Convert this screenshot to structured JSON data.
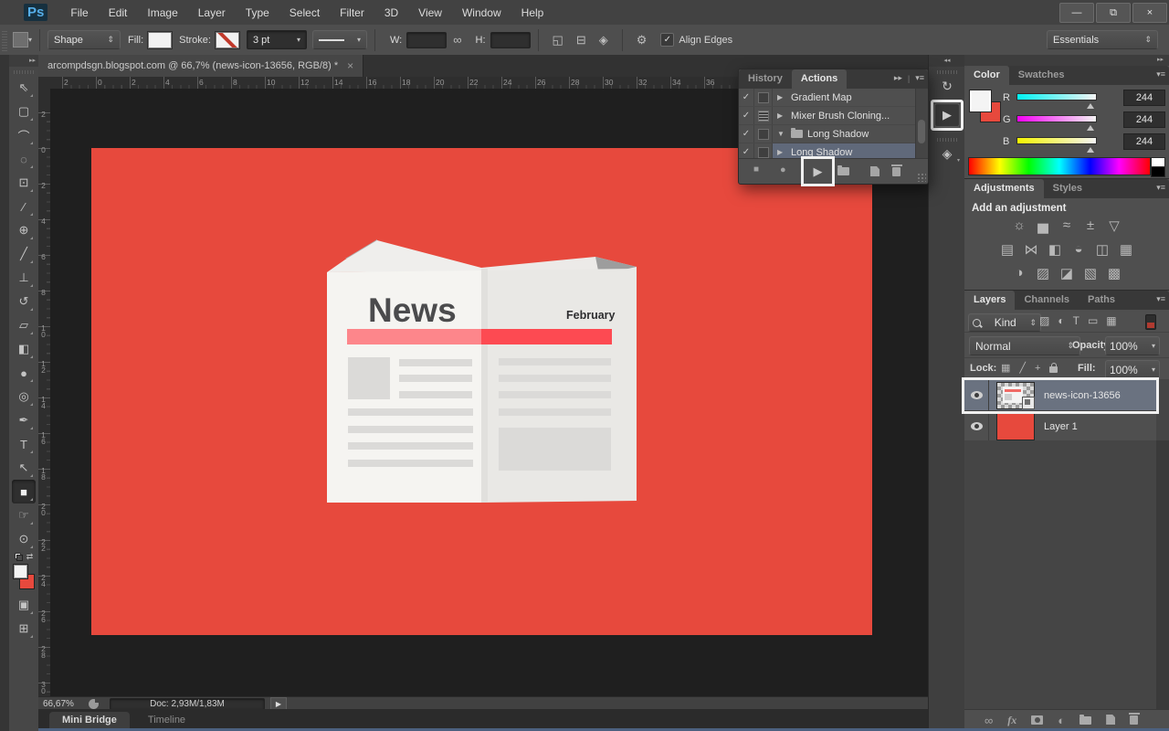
{
  "colors": {
    "canvas_red": "#e7493d",
    "banner_left": "#fd868b",
    "banner_right": "#fd4a52",
    "selection_blue": "#6a7280",
    "annotation_white": "#f0f0f0"
  },
  "window": {
    "controls": [
      {
        "name": "minimize-button",
        "glyph": "—"
      },
      {
        "name": "restore-button",
        "glyph": "⧉"
      },
      {
        "name": "close-button",
        "glyph": "×"
      }
    ]
  },
  "menubar": {
    "logo": "Ps",
    "items": [
      "File",
      "Edit",
      "Image",
      "Layer",
      "Type",
      "Select",
      "Filter",
      "3D",
      "View",
      "Window",
      "Help"
    ]
  },
  "options_bar": {
    "tool_mode": "Shape",
    "fill_label": "Fill:",
    "stroke_label": "Stroke:",
    "stroke_width": "3 pt",
    "w_label": "W:",
    "h_label": "H:",
    "align_edges_label": "Align Edges",
    "align_edges_checked": "✓",
    "workspace": "Essentials",
    "icons": [
      {
        "name": "path-operations-icon",
        "glyph": "◱"
      },
      {
        "name": "path-alignment-icon",
        "glyph": "⊟"
      },
      {
        "name": "path-arrangement-icon",
        "glyph": "◈"
      },
      {
        "name": "gear-icon",
        "glyph": "⚙"
      },
      {
        "name": "link-dimensions-icon",
        "glyph": "∞"
      }
    ]
  },
  "document": {
    "tab_title": "arcompdsgn.blogspot.com @ 66,7% (news-icon-13656, RGB/8) *",
    "close_glyph": "×",
    "ruler_h": [
      "2",
      "0",
      "2",
      "4",
      "6",
      "8",
      "10",
      "12",
      "14",
      "16",
      "18",
      "20",
      "22",
      "24",
      "26",
      "28",
      "30",
      "32",
      "34",
      "36"
    ],
    "ruler_v": [
      "2",
      "0",
      "2",
      "4",
      "6",
      "8",
      "10",
      "12",
      "14",
      "16",
      "18",
      "20",
      "22",
      "24",
      "26",
      "28",
      "30"
    ],
    "status": {
      "zoom": "66,67%",
      "doc_info": "Doc: 2,93M/1,83M"
    },
    "bottom_tabs": [
      {
        "label": "Mini Bridge",
        "cls": "active"
      },
      {
        "label": "Timeline",
        "cls": ""
      }
    ]
  },
  "artwork": {
    "title": "News",
    "date": "February"
  },
  "toolbar": {
    "collapse_glyph": "▸▸",
    "swap_glyph": "⇄",
    "tools": [
      {
        "name": "move-tool",
        "glyph": "⇖"
      },
      {
        "name": "rectangular-marquee-tool",
        "glyph": "▢"
      },
      {
        "name": "lasso-tool",
        "glyph": "⌒"
      },
      {
        "name": "quick-selection-tool",
        "glyph": "◌"
      },
      {
        "name": "crop-tool",
        "glyph": "⊡"
      },
      {
        "name": "eyedropper-tool",
        "glyph": "∕"
      },
      {
        "name": "spot-healing-brush-tool",
        "glyph": "⊕"
      },
      {
        "name": "brush-tool",
        "glyph": "╱"
      },
      {
        "name": "clone-stamp-tool",
        "glyph": "⊥"
      },
      {
        "name": "history-brush-tool",
        "glyph": "↺"
      },
      {
        "name": "eraser-tool",
        "glyph": "▱"
      },
      {
        "name": "gradient-tool",
        "glyph": "◧"
      },
      {
        "name": "blur-tool",
        "glyph": "●"
      },
      {
        "name": "dodge-tool",
        "glyph": "◎"
      },
      {
        "name": "pen-tool",
        "glyph": "✒"
      },
      {
        "name": "type-tool",
        "glyph": "T"
      },
      {
        "name": "path-selection-tool",
        "glyph": "↖"
      },
      {
        "name": "rectangle-tool",
        "glyph": "■",
        "cls": "selected"
      },
      {
        "name": "hand-tool",
        "glyph": "☞"
      },
      {
        "name": "zoom-tool",
        "glyph": "⊙"
      }
    ],
    "tools_bottom": [
      {
        "name": "quick-mask-tool",
        "glyph": "▣"
      },
      {
        "name": "screen-mode-tool",
        "glyph": "⊞"
      }
    ]
  },
  "actions_panel": {
    "tabs": [
      {
        "label": "History",
        "cls": ""
      },
      {
        "label": "Actions",
        "cls": "active"
      }
    ],
    "expand_glyph": "▸▸",
    "menu_glyph": "▾≡",
    "items": [
      {
        "check": "✓",
        "arrow": "▶",
        "label": "Gradient Map",
        "cls": ""
      },
      {
        "check": "✓",
        "arrow": "▶",
        "label": "Mixer Brush Cloning...",
        "cls": "modal"
      },
      {
        "check": "✓",
        "arrow": "▼",
        "label": "Long Shadow",
        "cls": "set"
      },
      {
        "check": "✓",
        "arrow": "▶",
        "label": "Long Shadow",
        "cls": "selected"
      }
    ],
    "buttons": [
      {
        "name": "stop-playing-button",
        "glyph": "■"
      },
      {
        "name": "begin-recording-button",
        "glyph": "●"
      },
      {
        "name": "play-selection-button",
        "glyph": "▶"
      },
      {
        "name": "create-new-set-button"
      },
      {
        "name": "create-new-action-button"
      },
      {
        "name": "delete-action-button"
      }
    ]
  },
  "dock_strip": {
    "collapse_glyph": "◂◂",
    "icons": [
      {
        "name": "collapsed-history-panel-icon",
        "glyph": "↻"
      },
      {
        "name": "collapsed-actions-play-button",
        "glyph": "▶"
      },
      {
        "name": "collapsed-properties-panel-icon",
        "glyph": "◈"
      }
    ]
  },
  "dock": {
    "collapse_glyph": "▸▸"
  },
  "color_panel": {
    "tabs": [
      {
        "label": "Color",
        "cls": "active"
      },
      {
        "label": "Swatches",
        "cls": ""
      }
    ],
    "menu_glyph": "▾≡",
    "channels": [
      {
        "label": "R",
        "value": "244",
        "cls": "r"
      },
      {
        "label": "G",
        "value": "244",
        "cls": "g"
      },
      {
        "label": "B",
        "value": "244",
        "cls": "b"
      }
    ]
  },
  "adjustments_panel": {
    "tabs": [
      {
        "label": "Adjustments",
        "cls": "active"
      },
      {
        "label": "Styles",
        "cls": ""
      }
    ],
    "menu_glyph": "▾≡",
    "heading": "Add an adjustment",
    "row1": [
      {
        "name": "brightness-contrast-icon",
        "glyph": "☼"
      },
      {
        "name": "levels-icon",
        "glyph": "▅"
      },
      {
        "name": "curves-icon",
        "glyph": "≈"
      },
      {
        "name": "exposure-icon",
        "glyph": "±"
      },
      {
        "name": "vibrance-icon",
        "glyph": "▽"
      }
    ],
    "row2": [
      {
        "name": "hue-saturation-icon",
        "glyph": "▤"
      },
      {
        "name": "color-balance-icon",
        "glyph": "⋈"
      },
      {
        "name": "black-white-icon",
        "glyph": "◧"
      },
      {
        "name": "photo-filter-icon",
        "glyph": "◒"
      },
      {
        "name": "channel-mixer-icon",
        "glyph": "◫"
      },
      {
        "name": "color-lookup-icon",
        "glyph": "▦"
      }
    ],
    "row3": [
      {
        "name": "invert-icon",
        "glyph": "◑"
      },
      {
        "name": "posterize-icon",
        "glyph": "▨"
      },
      {
        "name": "threshold-icon",
        "glyph": "◪"
      },
      {
        "name": "gradient-map-icon",
        "glyph": "▧"
      },
      {
        "name": "selective-color-icon",
        "glyph": "▩"
      }
    ]
  },
  "layers_panel": {
    "tabs": [
      {
        "label": "Layers",
        "cls": "active"
      },
      {
        "label": "Channels",
        "cls": ""
      },
      {
        "label": "Paths",
        "cls": ""
      }
    ],
    "menu_glyph": "▾≡",
    "filter_label": "Kind",
    "filter_icons": [
      {
        "name": "filter-image-layers-icon",
        "glyph": "▨"
      },
      {
        "name": "filter-adjustment-layers-icon",
        "glyph": "◐"
      },
      {
        "name": "filter-type-layers-icon",
        "glyph": "T"
      },
      {
        "name": "filter-shape-layers-icon",
        "glyph": "▭"
      },
      {
        "name": "filter-smart-objects-icon",
        "glyph": "▦"
      }
    ],
    "blend_mode": "Normal",
    "opacity_label": "Opacity:",
    "opacity_value": "100%",
    "lock_label": "Lock:",
    "lock_icons": [
      {
        "name": "lock-transparent-pixels-icon",
        "glyph": "▦"
      },
      {
        "name": "lock-image-pixels-icon",
        "glyph": "╱"
      },
      {
        "name": "lock-position-icon",
        "glyph": "+"
      }
    ],
    "fill_label": "Fill:",
    "fill_value": "100%",
    "layers": [
      {
        "label": "news-icon-13656",
        "cls": "selected news"
      },
      {
        "label": "Layer 1",
        "cls": "red"
      }
    ],
    "buttons": [
      {
        "name": "link-layers-icon",
        "glyph": "∞"
      },
      {
        "name": "layer-effects-icon",
        "glyph": "fx"
      },
      {
        "name": "layer-mask-icon"
      },
      {
        "name": "new-adjustment-layer-icon",
        "glyph": "◐"
      },
      {
        "name": "new-group-icon"
      },
      {
        "name": "new-layer-icon"
      },
      {
        "name": "delete-layer-icon"
      }
    ]
  }
}
